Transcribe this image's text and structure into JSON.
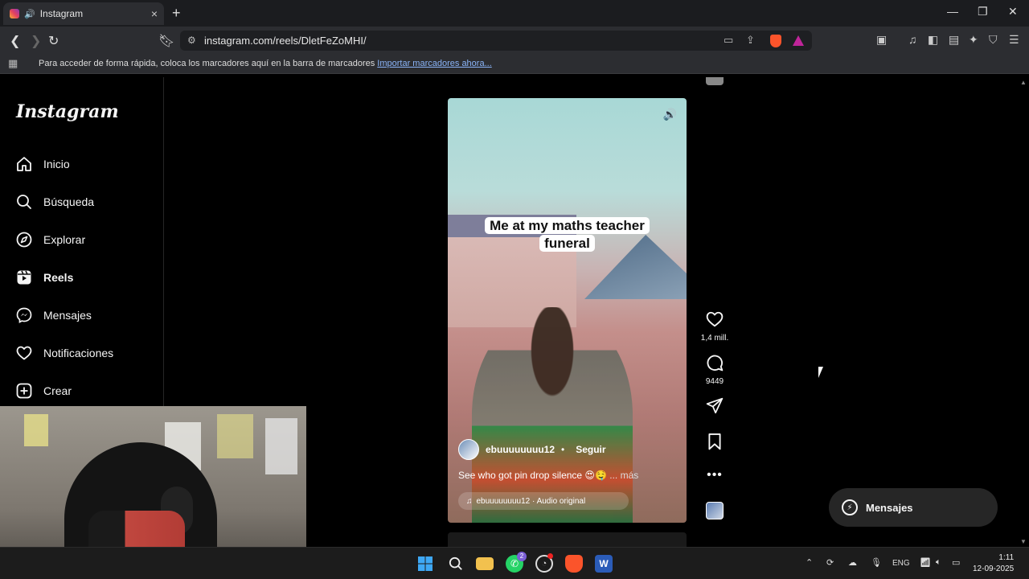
{
  "browser": {
    "tab_title": "Instagram",
    "tab_close": "×",
    "new_tab": "+",
    "url": "instagram.com/reels/DletFeZoMHI/",
    "bookmarks_message": "Para acceder de forma rápida, coloca los marcadores aquí en la barra de marcadores",
    "bookmarks_link": "Importar marcadores ahora..."
  },
  "sidebar": {
    "logo": "Instagram",
    "items": [
      {
        "label": "Inicio",
        "icon": "home-icon"
      },
      {
        "label": "Búsqueda",
        "icon": "search-icon"
      },
      {
        "label": "Explorar",
        "icon": "compass-icon"
      },
      {
        "label": "Reels",
        "icon": "reels-icon"
      },
      {
        "label": "Mensajes",
        "icon": "messenger-icon"
      },
      {
        "label": "Notificaciones",
        "icon": "heart-icon"
      },
      {
        "label": "Crear",
        "icon": "plus-square-icon"
      }
    ]
  },
  "reel": {
    "caption_line1": "Me at my maths teacher",
    "caption_line2": "funeral",
    "author": "ebuuuuuuuu12",
    "separator": "•",
    "follow": "Seguir",
    "description": "See who got pin drop silence 😍🤤",
    "more": "... más",
    "audio": "ebuuuuuuuu12 · Audio original"
  },
  "actions": {
    "likes": "1,4 mill.",
    "comments": "9449"
  },
  "messages_button": "Mensajes",
  "taskbar": {
    "lang": "ENG",
    "time": "1:11",
    "date": "12-09-2025",
    "whatsapp_badge": "2"
  }
}
